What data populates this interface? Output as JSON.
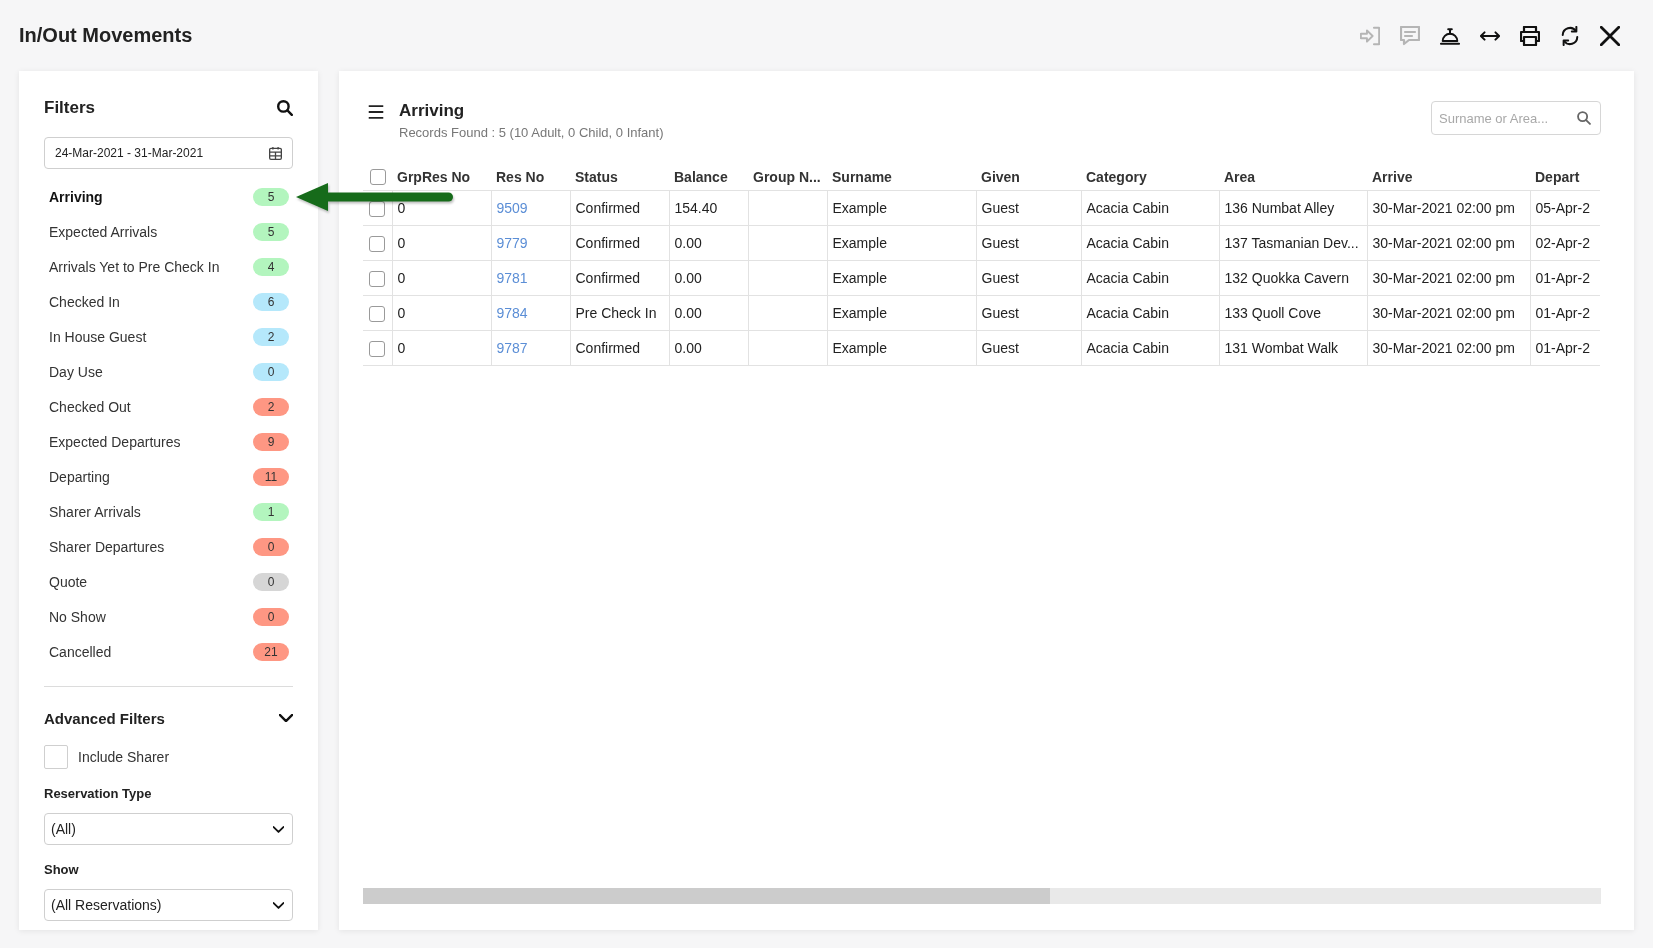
{
  "window": {
    "title": "In/Out Movements"
  },
  "toolbar": [
    {
      "kind": "sign-in",
      "disabled": true
    },
    {
      "kind": "comment",
      "disabled": true
    },
    {
      "kind": "bell",
      "disabled": false
    },
    {
      "kind": "resize",
      "disabled": false
    },
    {
      "kind": "print",
      "disabled": false
    },
    {
      "kind": "refresh",
      "disabled": false
    },
    {
      "kind": "close",
      "disabled": false
    }
  ],
  "filters": {
    "title": "Filters",
    "date_range": "24-Mar-2021 - 31-Mar-2021",
    "items": [
      {
        "label": "Arriving",
        "count": "5",
        "color": "#b3f5be",
        "selected": true
      },
      {
        "label": "Expected Arrivals",
        "count": "5",
        "color": "#b3f5be",
        "selected": false
      },
      {
        "label": "Arrivals Yet to Pre Check In",
        "count": "4",
        "color": "#b3f5be",
        "selected": false
      },
      {
        "label": "Checked In",
        "count": "6",
        "color": "#b5e8fb",
        "selected": false
      },
      {
        "label": "In House Guest",
        "count": "2",
        "color": "#b5e8fb",
        "selected": false
      },
      {
        "label": "Day Use",
        "count": "0",
        "color": "#b5e8fb",
        "selected": false
      },
      {
        "label": "Checked Out",
        "count": "2",
        "color": "#fe9783",
        "selected": false
      },
      {
        "label": "Expected Departures",
        "count": "9",
        "color": "#fe9783",
        "selected": false
      },
      {
        "label": "Departing",
        "count": "11",
        "color": "#fe9783",
        "selected": false
      },
      {
        "label": "Sharer Arrivals",
        "count": "1",
        "color": "#b3f5be",
        "selected": false
      },
      {
        "label": "Sharer Departures",
        "count": "0",
        "color": "#fe9783",
        "selected": false
      },
      {
        "label": "Quote",
        "count": "0",
        "color": "#d6d6d6",
        "selected": false
      },
      {
        "label": "No Show",
        "count": "0",
        "color": "#fe9783",
        "selected": false
      },
      {
        "label": "Cancelled",
        "count": "21",
        "color": "#fe9783",
        "selected": false
      }
    ]
  },
  "advanced_filters": {
    "title": "Advanced Filters",
    "expanded": true,
    "include_sharer": {
      "label": "Include Sharer",
      "checked": false
    },
    "fields": [
      {
        "label": "Reservation Type",
        "value": "(All)"
      },
      {
        "label": "Show",
        "value": "(All Reservations)"
      }
    ]
  },
  "list": {
    "title": "Arriving",
    "summary": "Records Found : 5 (10 Adult, 0 Child, 0 Infant)",
    "search": {
      "placeholder": "Surname or Area..."
    }
  },
  "table": {
    "select_all_checked": false,
    "columns": [
      "GrpRes No",
      "Res No",
      "Status",
      "Balance",
      "Group N...",
      "Surname",
      "Given",
      "Category",
      "Area",
      "Arrive",
      "Depart"
    ],
    "rows": [
      {
        "checked": false,
        "grpres_no": "0",
        "res_no": "9509",
        "status": "Confirmed",
        "balance": "154.40",
        "surname": "Example",
        "given": "Guest",
        "category": "Acacia Cabin",
        "area": "136 Numbat Alley",
        "arrive": "30-Mar-2021 02:00 pm",
        "depart": "05-Apr-2"
      },
      {
        "checked": false,
        "grpres_no": "0",
        "res_no": "9779",
        "status": "Confirmed",
        "balance": "0.00",
        "surname": "Example",
        "given": "Guest",
        "category": "Acacia Cabin",
        "area": "137 Tasmanian Dev...",
        "arrive": "30-Mar-2021 02:00 pm",
        "depart": "02-Apr-2"
      },
      {
        "checked": false,
        "grpres_no": "0",
        "res_no": "9781",
        "status": "Confirmed",
        "balance": "0.00",
        "surname": "Example",
        "given": "Guest",
        "category": "Acacia Cabin",
        "area": "132 Quokka Cavern",
        "arrive": "30-Mar-2021 02:00 pm",
        "depart": "01-Apr-2"
      },
      {
        "checked": false,
        "grpres_no": "0",
        "res_no": "9784",
        "status": "Pre Check In",
        "balance": "0.00",
        "surname": "Example",
        "given": "Guest",
        "category": "Acacia Cabin",
        "area": "133 Quoll Cove",
        "arrive": "30-Mar-2021 02:00 pm",
        "depart": "01-Apr-2"
      },
      {
        "checked": false,
        "grpres_no": "0",
        "res_no": "9787",
        "status": "Confirmed",
        "balance": "0.00",
        "surname": "Example",
        "given": "Guest",
        "category": "Acacia Cabin",
        "area": "131 Wombat Walk",
        "arrive": "30-Mar-2021 02:00 pm",
        "depart": "01-Apr-2"
      }
    ]
  }
}
